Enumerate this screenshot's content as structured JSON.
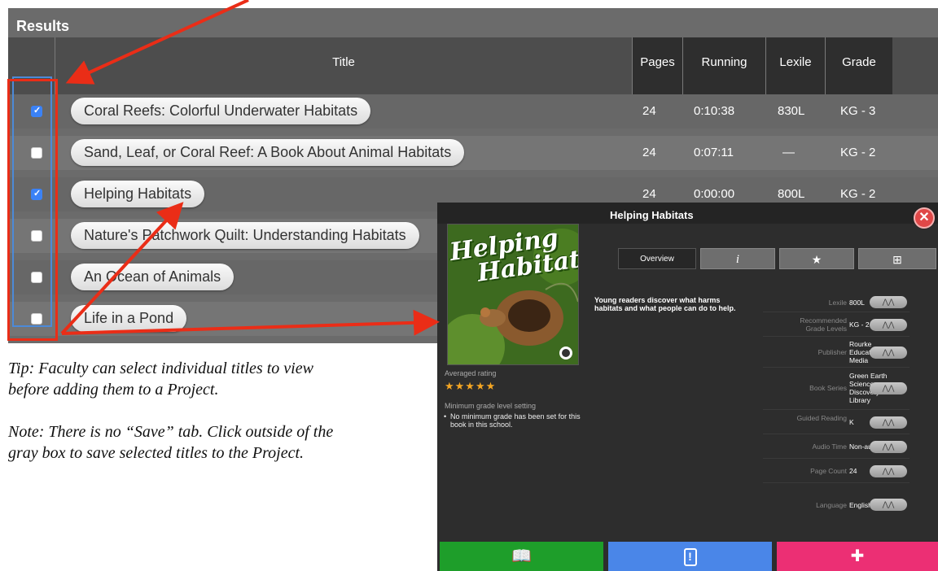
{
  "results": {
    "title": "Results",
    "columns": {
      "title": "Title",
      "pages": "Pages",
      "running": "Running",
      "lexile": "Lexile",
      "grade": "Grade"
    },
    "rows": [
      {
        "title": "Coral Reefs: Colorful Underwater Habitats",
        "pages": "24",
        "running": "0:10:38",
        "lexile": "830L",
        "grade": "KG - 3",
        "checked": true
      },
      {
        "title": "Sand, Leaf, or Coral Reef: A Book About Animal Habitats",
        "pages": "24",
        "running": "0:07:11",
        "lexile": "—",
        "grade": "KG - 2",
        "checked": false
      },
      {
        "title": "Helping Habitats",
        "pages": "24",
        "running": "0:00:00",
        "lexile": "800L",
        "grade": "KG - 2",
        "checked": true
      },
      {
        "title": "Nature's Patchwork Quilt: Understanding Habitats",
        "checked": false
      },
      {
        "title": "An Ocean of Animals",
        "checked": false
      },
      {
        "title": "Life in a Pond",
        "checked": false
      }
    ]
  },
  "tip": {
    "line1": "Tip:  Faculty can select individual titles to view before adding them to a Project.",
    "line2": "Note: There is no “Save” tab.  Click outside of the gray box to save selected titles to the Project."
  },
  "detail": {
    "title": "Helping Habitats",
    "close_glyph": "✕",
    "cover_title_1": "Helping",
    "cover_title_2": "Habitats",
    "averaged_rating_label": "Averaged rating",
    "stars": "★★★★★",
    "rating": 5,
    "min_grade_label": "Minimum grade level setting",
    "min_grade_text": "No minimum grade has been set for this book in this school.",
    "tabs": {
      "overview": "Overview",
      "info_glyph": "i",
      "star_glyph": "★",
      "folder_glyph": "⊞"
    },
    "description": "Young readers discover what harms habitats and what people can do to help.",
    "meta": [
      {
        "label": "Lexile",
        "value": "800L"
      },
      {
        "label": "Recommended Grade Levels",
        "value": "KG - 2"
      },
      {
        "label": "Publisher",
        "value": "Rourke Educational Media"
      },
      {
        "label": "Book Series",
        "value": "Green Earth Science Discovery Library"
      },
      {
        "label": "Guided Reading",
        "value": "K"
      },
      {
        "label": "Audio Time",
        "value": "Non-audio"
      },
      {
        "label": "Page Count",
        "value": "24"
      },
      {
        "label": "Language",
        "value": "English"
      }
    ],
    "meta_button_glyph": "⋀⋀",
    "bottom": {
      "read_glyph": "📖",
      "alert_glyph": "!",
      "fav_glyph": "✚"
    },
    "colors": {
      "read": "#1e9e2a",
      "alert": "#4a86e8",
      "fav": "#ec2f74"
    }
  },
  "annotation_color": "#ea2d17"
}
